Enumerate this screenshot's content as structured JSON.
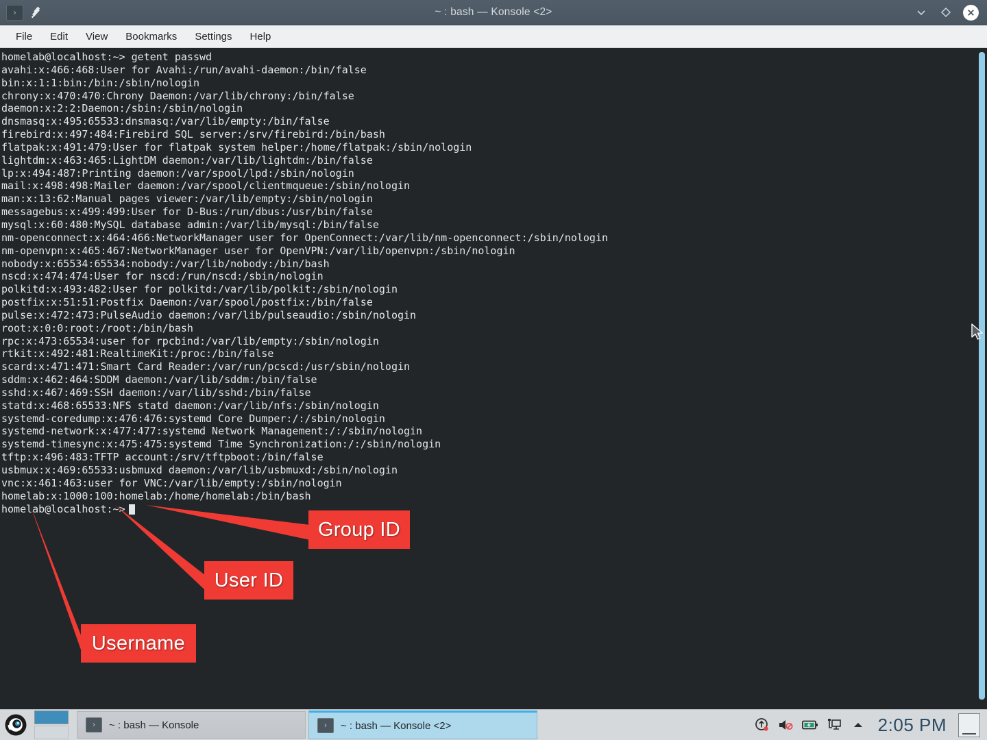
{
  "window": {
    "title": "~ : bash — Konsole <2>",
    "app_icon": "konsole-icon",
    "pin_icon": "pin-icon",
    "controls": {
      "minimize": "chevron-down-icon",
      "maximize": "diamond-icon",
      "close": "close-icon"
    }
  },
  "menubar": {
    "items": [
      {
        "label": "File"
      },
      {
        "label": "Edit"
      },
      {
        "label": "View"
      },
      {
        "label": "Bookmarks"
      },
      {
        "label": "Settings"
      },
      {
        "label": "Help"
      }
    ]
  },
  "terminal": {
    "prompt": "homelab@localhost:~>",
    "command": "getent passwd",
    "first_line": "homelab@localhost:~> getent passwd",
    "last_line": "homelab@localhost:~>",
    "lines": [
      "homelab@localhost:~> getent passwd",
      "avahi:x:466:468:User for Avahi:/run/avahi-daemon:/bin/false",
      "bin:x:1:1:bin:/bin:/sbin/nologin",
      "chrony:x:470:470:Chrony Daemon:/var/lib/chrony:/bin/false",
      "daemon:x:2:2:Daemon:/sbin:/sbin/nologin",
      "dnsmasq:x:495:65533:dnsmasq:/var/lib/empty:/bin/false",
      "firebird:x:497:484:Firebird SQL server:/srv/firebird:/bin/bash",
      "flatpak:x:491:479:User for flatpak system helper:/home/flatpak:/sbin/nologin",
      "lightdm:x:463:465:LightDM daemon:/var/lib/lightdm:/bin/false",
      "lp:x:494:487:Printing daemon:/var/spool/lpd:/sbin/nologin",
      "mail:x:498:498:Mailer daemon:/var/spool/clientmqueue:/sbin/nologin",
      "man:x:13:62:Manual pages viewer:/var/lib/empty:/sbin/nologin",
      "messagebus:x:499:499:User for D-Bus:/run/dbus:/usr/bin/false",
      "mysql:x:60:480:MySQL database admin:/var/lib/mysql:/bin/false",
      "nm-openconnect:x:464:466:NetworkManager user for OpenConnect:/var/lib/nm-openconnect:/sbin/nologin",
      "nm-openvpn:x:465:467:NetworkManager user for OpenVPN:/var/lib/openvpn:/sbin/nologin",
      "nobody:x:65534:65534:nobody:/var/lib/nobody:/bin/bash",
      "nscd:x:474:474:User for nscd:/run/nscd:/sbin/nologin",
      "polkitd:x:493:482:User for polkitd:/var/lib/polkit:/sbin/nologin",
      "postfix:x:51:51:Postfix Daemon:/var/spool/postfix:/bin/false",
      "pulse:x:472:473:PulseAudio daemon:/var/lib/pulseaudio:/sbin/nologin",
      "root:x:0:0:root:/root:/bin/bash",
      "rpc:x:473:65534:user for rpcbind:/var/lib/empty:/sbin/nologin",
      "rtkit:x:492:481:RealtimeKit:/proc:/bin/false",
      "scard:x:471:471:Smart Card Reader:/var/run/pcscd:/usr/sbin/nologin",
      "sddm:x:462:464:SDDM daemon:/var/lib/sddm:/bin/false",
      "sshd:x:467:469:SSH daemon:/var/lib/sshd:/bin/false",
      "statd:x:468:65533:NFS statd daemon:/var/lib/nfs:/sbin/nologin",
      "systemd-coredump:x:476:476:systemd Core Dumper:/:/sbin/nologin",
      "systemd-network:x:477:477:systemd Network Management:/:/sbin/nologin",
      "systemd-timesync:x:475:475:systemd Time Synchronization:/:/sbin/nologin",
      "tftp:x:496:483:TFTP account:/srv/tftpboot:/bin/false",
      "usbmux:x:469:65533:usbmuxd daemon:/var/lib/usbmuxd:/sbin/nologin",
      "vnc:x:461:463:user for VNC:/var/lib/empty:/sbin/nologin",
      "homelab:x:1000:100:homelab:/home/homelab:/bin/bash"
    ]
  },
  "annotations": {
    "color": "#f03b34",
    "items": [
      {
        "label": "Group ID"
      },
      {
        "label": "User ID"
      },
      {
        "label": "Username"
      }
    ]
  },
  "taskbar": {
    "launcher_icon": "opensuse-chameleon-icon",
    "tasks": [
      {
        "label": "~ : bash — Konsole",
        "icon": "konsole-icon",
        "active": false
      },
      {
        "label": "~ : bash — Konsole <2>",
        "icon": "konsole-icon",
        "active": true
      }
    ],
    "tray": [
      {
        "name": "software-update-icon"
      },
      {
        "name": "volume-muted-icon"
      },
      {
        "name": "battery-charging-icon"
      },
      {
        "name": "network-display-icon"
      },
      {
        "name": "show-hidden-icons-icon"
      }
    ],
    "clock": "2:05 PM",
    "show_desktop": "show-desktop-icon"
  }
}
